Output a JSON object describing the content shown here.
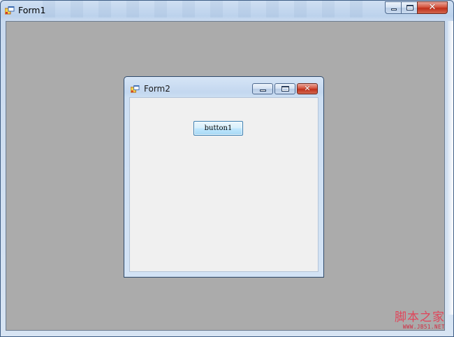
{
  "form1": {
    "title": "Form1",
    "buttons": {
      "minimize": "minimize",
      "maximize": "maximize",
      "close": "✕"
    }
  },
  "form2": {
    "title": "Form2",
    "buttons": {
      "minimize": "minimize",
      "maximize": "maximize",
      "close": "✕"
    },
    "button1_label": "button1"
  },
  "watermark": {
    "text": "脚本之家",
    "url": "WWW.JB51.NET"
  },
  "colors": {
    "mdi_background": "#ababab",
    "client_background": "#f0f0f0",
    "close_button": "#c0301b"
  },
  "icons": [
    "app-icon",
    "minimize-icon",
    "maximize-icon",
    "close-icon"
  ]
}
